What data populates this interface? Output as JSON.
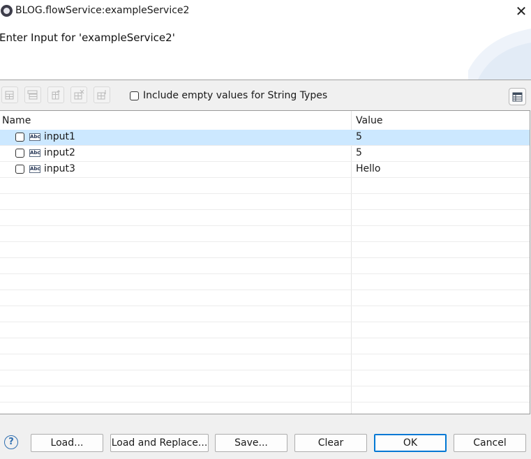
{
  "window": {
    "title": "BLOG.flowService:exampleService2",
    "close_symbol": "✕",
    "icon": "settings-gear-icon"
  },
  "header": {
    "title": "Enter Input for 'exampleService2'"
  },
  "toolbar": {
    "buttons": [
      {
        "icon": "add-row-icon"
      },
      {
        "icon": "insert-row-icon"
      },
      {
        "icon": "add-child-icon"
      },
      {
        "icon": "delete-row-icon"
      },
      {
        "icon": "edit-row-icon"
      }
    ],
    "include_empty": {
      "label": "Include empty values for String Types",
      "checked": false
    },
    "columns_icon": "table-view-icon"
  },
  "table": {
    "columns": [
      "Name",
      "Value"
    ],
    "rows": [
      {
        "name": "input1",
        "value": "5",
        "type_icon": "Abc",
        "checked": false,
        "selected": true
      },
      {
        "name": "input2",
        "value": "5",
        "type_icon": "Abc",
        "checked": false,
        "selected": false
      },
      {
        "name": "input3",
        "value": "Hello",
        "type_icon": "Abc",
        "checked": false,
        "selected": false
      }
    ]
  },
  "footer": {
    "help_symbol": "?",
    "buttons": {
      "load": "Load...",
      "load_replace": "Load and Replace...",
      "save": "Save...",
      "clear": "Clear",
      "ok": "OK",
      "cancel": "Cancel"
    }
  },
  "colors": {
    "selection": "#cce8ff",
    "accent": "#0078d4"
  }
}
